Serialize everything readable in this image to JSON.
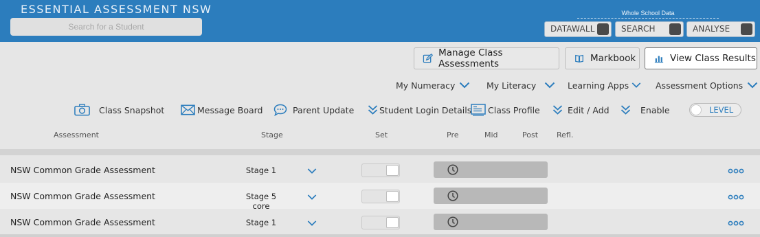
{
  "header": {
    "title": "ESSENTIAL ASSESSMENT NSW",
    "search_placeholder": "Search for a Student",
    "whole_school_label": "Whole School Data",
    "toggles": [
      {
        "label": "DATAWALL"
      },
      {
        "label": "SEARCH"
      },
      {
        "label": "ANALYSE"
      }
    ]
  },
  "actions": {
    "manage": "Manage Class Assessments",
    "markbook": "Markbook",
    "view_results": "View Class Results"
  },
  "menus": {
    "numeracy": "My Numeracy",
    "literacy": "My Literacy",
    "learning_apps": "Learning Apps",
    "assessment_options": "Assessment Options"
  },
  "toolbar": {
    "class_snapshot": "Class Snapshot",
    "message_board": "Message Board",
    "parent_update": "Parent Update",
    "student_login": "Student Login Details",
    "class_profile": "Class Profile",
    "edit_add": "Edit / Add",
    "enable": "Enable",
    "level": "LEVEL"
  },
  "columns": {
    "assessment": "Assessment",
    "stage": "Stage",
    "set": "Set",
    "pre": "Pre",
    "mid": "Mid",
    "post": "Post",
    "refl": "Refl."
  },
  "rows": [
    {
      "assessment": "NSW Common Grade Assessment",
      "stage": "Stage 1"
    },
    {
      "assessment": "NSW Common Grade Assessment",
      "stage": "Stage 5 core"
    },
    {
      "assessment": "NSW Common Grade Assessment",
      "stage": "Stage 1"
    }
  ],
  "colors": {
    "header_bg": "#2c7dbd",
    "accent": "#2c7dbd",
    "pre_bar": "#b8b8b8"
  }
}
